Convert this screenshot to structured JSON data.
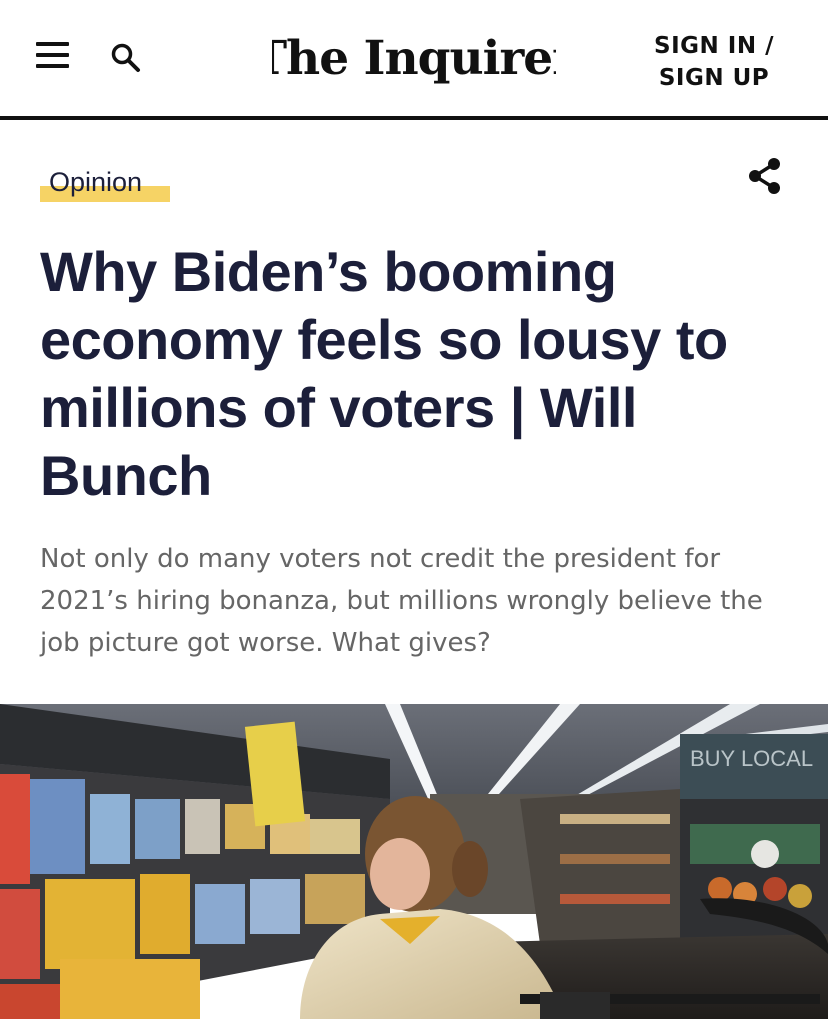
{
  "header": {
    "logo_text": "The Inquirer",
    "signin_line1": "SIGN IN /",
    "signin_line2": "SIGN UP"
  },
  "article": {
    "section": "Opinion",
    "headline": "Why Biden’s booming economy feels so lousy to millions of voters | Will Bunch",
    "dek": "Not only do many voters not credit the president for 2021’s hiring bonanza, but millions wrongly believe the job picture got worse. What gives?"
  },
  "photo": {
    "store_sign": "BUY LOCAL"
  },
  "colors": {
    "headline": "#1c1f3a",
    "section_highlight": "#f6d365",
    "dek": "#666666"
  },
  "icons": [
    "menu-icon",
    "search-icon",
    "share-icon"
  ]
}
